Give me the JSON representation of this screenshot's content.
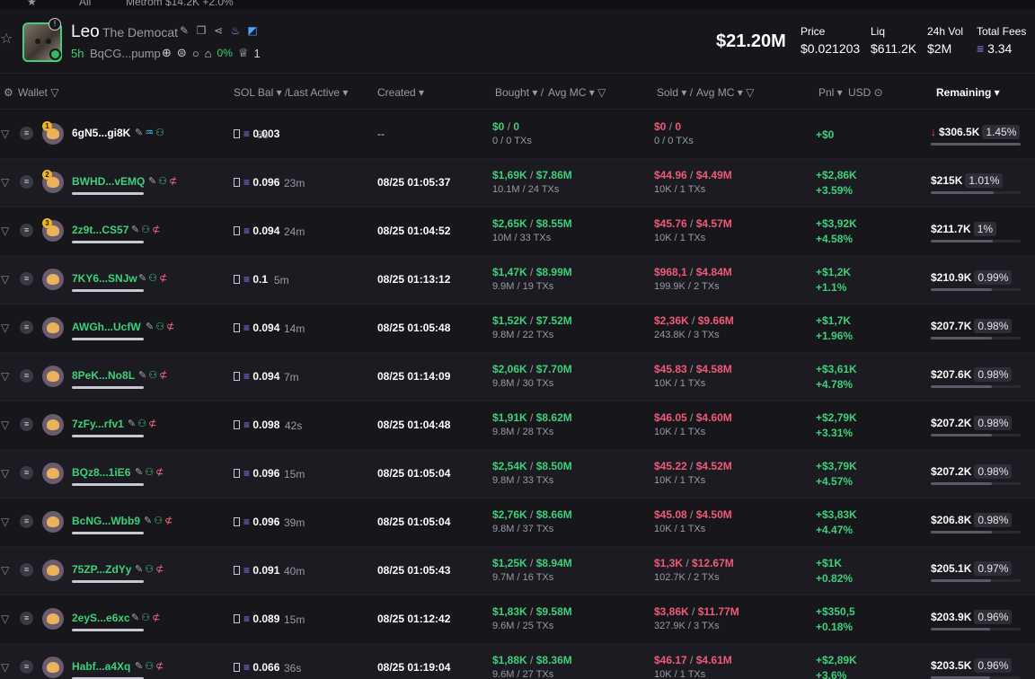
{
  "topstrip": {
    "all_label": "All",
    "fragment": "Metrom  $14.2K  +2.0%"
  },
  "token": {
    "name": "Leo",
    "subtitle": "The Democat",
    "age": "5h",
    "address": "BqCG...pump",
    "holder_pct": "0%",
    "crown_count": "1",
    "market_cap": "$21.20M"
  },
  "stats": [
    {
      "label": "Price",
      "value": "$0.021203"
    },
    {
      "label": "Liq",
      "value": "$611.2K"
    },
    {
      "label": "24h Vol",
      "value": "$2M"
    },
    {
      "label": "Total Fees",
      "value": "3.34"
    }
  ],
  "columns": {
    "wallet": "Wallet",
    "sol_bal": "SOL Bal",
    "last_active": "Last Active",
    "created": "Created",
    "bought": "Bought",
    "avg_mc_b": "Avg MC",
    "sold": "Sold",
    "avg_mc_s": "Avg MC",
    "pnl": "Pnl",
    "usd": "USD",
    "remaining": "Remaining"
  },
  "rows": [
    {
      "rank": "1",
      "wallet": "6gN5...gi8K",
      "sol": "0.003",
      "active": "8s",
      "created": "--",
      "bought": "$0",
      "bought_mc": "0",
      "bought_sub": "0 / 0 TXs",
      "sold": "$0",
      "sold_mc": "0",
      "sold_sub": "0 / 0 TXs",
      "pnl": "+$0",
      "pnl_pct": "",
      "remaining": "$306.5K",
      "rem_pct": "1.45%",
      "rem_frac": 0.0145
    },
    {
      "rank": "2",
      "wallet": "BWHD...vEMQ",
      "sol": "0.096",
      "active": "23m",
      "created": "08/25 01:05:37",
      "bought": "$1,69K",
      "bought_mc": "$7.86M",
      "bought_sub": "10.1M / 24 TXs",
      "sold": "$44.96",
      "sold_mc": "$4.49M",
      "sold_sub": "10K / 1 TXs",
      "pnl": "+$2,86K",
      "pnl_pct": "+3.59%",
      "remaining": "$215K",
      "rem_pct": "1.01%",
      "rem_frac": 0.0101
    },
    {
      "rank": "3",
      "wallet": "2z9t...CS57",
      "sol": "0.094",
      "active": "24m",
      "created": "08/25 01:04:52",
      "bought": "$2,65K",
      "bought_mc": "$8.55M",
      "bought_sub": "10M / 33 TXs",
      "sold": "$45.76",
      "sold_mc": "$4.57M",
      "sold_sub": "10K / 1 TXs",
      "pnl": "+$3,92K",
      "pnl_pct": "+4.58%",
      "remaining": "$211.7K",
      "rem_pct": "1%",
      "rem_frac": 0.01
    },
    {
      "rank": "",
      "wallet": "7KY6...SNJw",
      "sol": "0.1",
      "active": "5m",
      "created": "08/25 01:13:12",
      "bought": "$1,47K",
      "bought_mc": "$8.99M",
      "bought_sub": "9.9M / 19 TXs",
      "sold": "$968,1",
      "sold_mc": "$4.84M",
      "sold_sub": "199.9K / 2 TXs",
      "pnl": "+$1,2K",
      "pnl_pct": "+1.1%",
      "remaining": "$210.9K",
      "rem_pct": "0.99%",
      "rem_frac": 0.0099
    },
    {
      "rank": "",
      "wallet": "AWGh...UcfW",
      "sol": "0.094",
      "active": "14m",
      "created": "08/25 01:05:48",
      "bought": "$1,52K",
      "bought_mc": "$7.52M",
      "bought_sub": "9.8M / 22 TXs",
      "sold": "$2,36K",
      "sold_mc": "$9.66M",
      "sold_sub": "243.8K / 3 TXs",
      "pnl": "+$1,7K",
      "pnl_pct": "+1.96%",
      "remaining": "$207.7K",
      "rem_pct": "0.98%",
      "rem_frac": 0.0098
    },
    {
      "rank": "",
      "wallet": "8PeK...No8L",
      "sol": "0.094",
      "active": "7m",
      "created": "08/25 01:14:09",
      "bought": "$2,06K",
      "bought_mc": "$7.70M",
      "bought_sub": "9.8M / 30 TXs",
      "sold": "$45.83",
      "sold_mc": "$4.58M",
      "sold_sub": "10K / 1 TXs",
      "pnl": "+$3,61K",
      "pnl_pct": "+4.78%",
      "remaining": "$207.6K",
      "rem_pct": "0.98%",
      "rem_frac": 0.0098
    },
    {
      "rank": "",
      "wallet": "7zFy...rfv1",
      "sol": "0.098",
      "active": "42s",
      "created": "08/25 01:04:48",
      "bought": "$1,91K",
      "bought_mc": "$8.62M",
      "bought_sub": "9.8M / 28 TXs",
      "sold": "$46.05",
      "sold_mc": "$4.60M",
      "sold_sub": "10K / 1 TXs",
      "pnl": "+$2,79K",
      "pnl_pct": "+3.31%",
      "remaining": "$207.2K",
      "rem_pct": "0.98%",
      "rem_frac": 0.0098
    },
    {
      "rank": "",
      "wallet": "BQz8...1iE6",
      "sol": "0.096",
      "active": "15m",
      "created": "08/25 01:05:04",
      "bought": "$2,54K",
      "bought_mc": "$8.50M",
      "bought_sub": "9.8M / 33 TXs",
      "sold": "$45.22",
      "sold_mc": "$4.52M",
      "sold_sub": "10K / 1 TXs",
      "pnl": "+$3,79K",
      "pnl_pct": "+4.57%",
      "remaining": "$207.2K",
      "rem_pct": "0.98%",
      "rem_frac": 0.0098
    },
    {
      "rank": "",
      "wallet": "BcNG...Wbb9",
      "sol": "0.096",
      "active": "39m",
      "created": "08/25 01:05:04",
      "bought": "$2,76K",
      "bought_mc": "$8.66M",
      "bought_sub": "9.8M / 37 TXs",
      "sold": "$45.08",
      "sold_mc": "$4.50M",
      "sold_sub": "10K / 1 TXs",
      "pnl": "+$3,83K",
      "pnl_pct": "+4.47%",
      "remaining": "$206.8K",
      "rem_pct": "0.98%",
      "rem_frac": 0.0098
    },
    {
      "rank": "",
      "wallet": "75ZP...ZdYy",
      "sol": "0.091",
      "active": "40m",
      "created": "08/25 01:05:43",
      "bought": "$1,25K",
      "bought_mc": "$8.94M",
      "bought_sub": "9.7M / 16 TXs",
      "sold": "$1,3K",
      "sold_mc": "$12.67M",
      "sold_sub": "102.7K / 2 TXs",
      "pnl": "+$1K",
      "pnl_pct": "+0.82%",
      "remaining": "$205.1K",
      "rem_pct": "0.97%",
      "rem_frac": 0.0097
    },
    {
      "rank": "",
      "wallet": "2eyS...e6xc",
      "sol": "0.089",
      "active": "15m",
      "created": "08/25 01:12:42",
      "bought": "$1,83K",
      "bought_mc": "$9.58M",
      "bought_sub": "9.6M / 25 TXs",
      "sold": "$3,86K",
      "sold_mc": "$11.77M",
      "sold_sub": "327.9K / 3 TXs",
      "pnl": "+$350,5",
      "pnl_pct": "+0.18%",
      "remaining": "$203.9K",
      "rem_pct": "0.96%",
      "rem_frac": 0.0096
    },
    {
      "rank": "",
      "wallet": "Habf...a4Xq",
      "sol": "0.066",
      "active": "36s",
      "created": "08/25 01:19:04",
      "bought": "$1,88K",
      "bought_mc": "$8.36M",
      "bought_sub": "9.6M / 27 TXs",
      "sold": "$46.17",
      "sold_mc": "$4.61M",
      "sold_sub": "10K / 1 TXs",
      "pnl": "+$2,89K",
      "pnl_pct": "+3.6%",
      "remaining": "$203.5K",
      "rem_pct": "0.96%",
      "rem_frac": 0.0096
    }
  ],
  "colors": {
    "accent_green": "#3ed07a",
    "accent_red": "#f0597a",
    "sol_purple": "#a179ff",
    "bg": "#16161b"
  }
}
